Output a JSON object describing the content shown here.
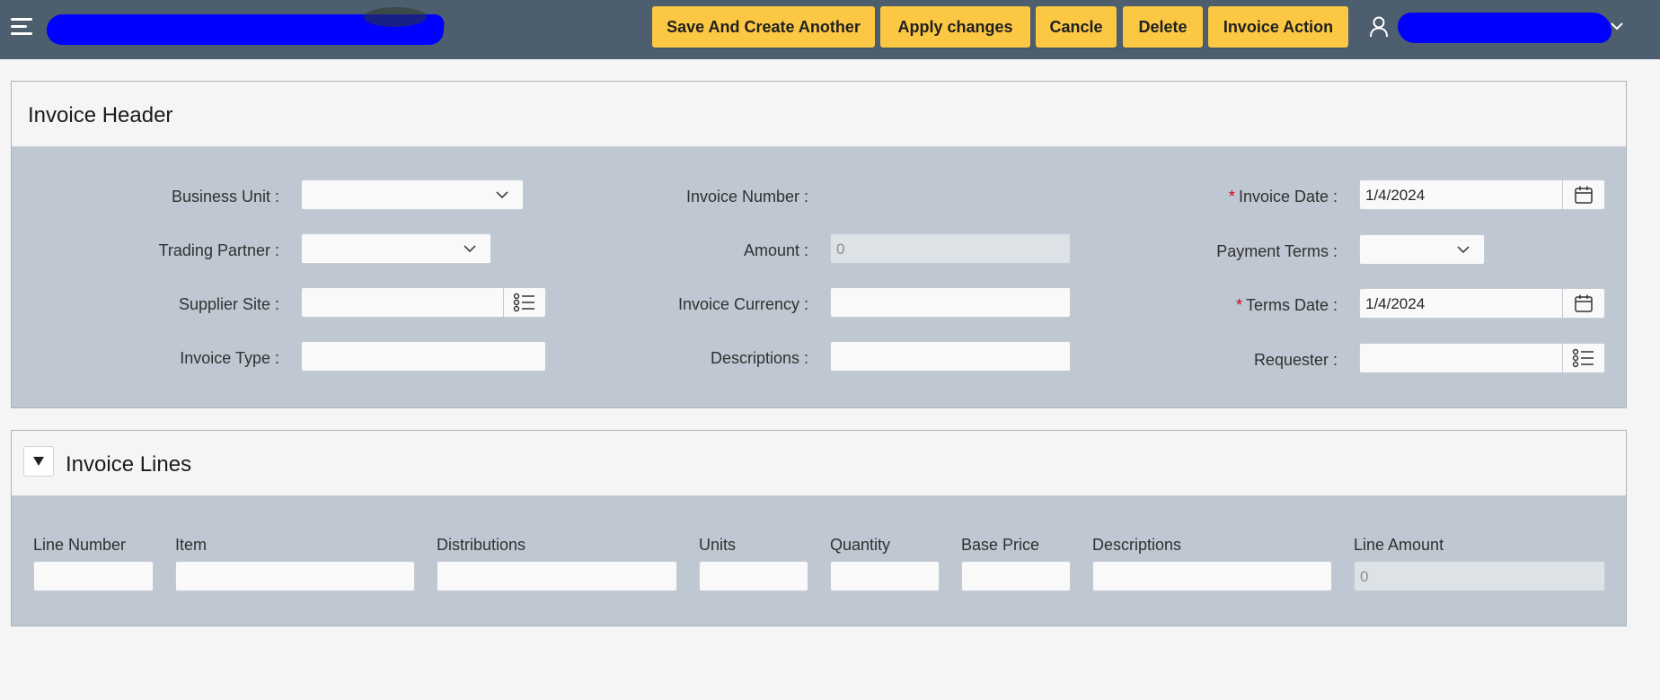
{
  "toolbar": {
    "buttons": [
      {
        "label": "Save And Create Another"
      },
      {
        "label": "Apply changes"
      },
      {
        "label": "Cancle"
      },
      {
        "label": "Delete"
      },
      {
        "label": "Invoice Action"
      }
    ],
    "accent_color": "#fcc844",
    "bar_color": "#4d5e6f"
  },
  "header_region": {
    "title": "Invoice Header",
    "fields": {
      "business_unit": {
        "label": "Business Unit :",
        "value": ""
      },
      "trading_partner": {
        "label": "Trading Partner :",
        "value": ""
      },
      "supplier_site": {
        "label": "Supplier Site :",
        "value": ""
      },
      "invoice_type": {
        "label": "Invoice Type :",
        "value": ""
      },
      "invoice_number": {
        "label": "Invoice Number :",
        "value": ""
      },
      "amount": {
        "label": "Amount :",
        "value": "0"
      },
      "invoice_currency": {
        "label": "Invoice Currency :",
        "value": ""
      },
      "descriptions": {
        "label": "Descriptions :",
        "value": ""
      },
      "invoice_date": {
        "label": "Invoice Date :",
        "value": "1/4/2024",
        "required": "*"
      },
      "payment_terms": {
        "label": "Payment Terms :",
        "value": ""
      },
      "terms_date": {
        "label": "Terms Date :",
        "value": "1/4/2024",
        "required": "*"
      },
      "requester": {
        "label": "Requester :",
        "value": ""
      }
    }
  },
  "lines_region": {
    "title": "Invoice Lines",
    "columns": {
      "line_number": {
        "label": "Line Number",
        "value": ""
      },
      "item": {
        "label": "Item",
        "value": ""
      },
      "distributions": {
        "label": "Distributions",
        "value": ""
      },
      "units": {
        "label": "Units",
        "value": ""
      },
      "quantity": {
        "label": "Quantity",
        "value": ""
      },
      "base_price": {
        "label": "Base Price",
        "value": ""
      },
      "descriptions": {
        "label": "Descriptions",
        "value": ""
      },
      "line_amount": {
        "label": "Line Amount",
        "value": "0"
      }
    }
  },
  "icons": {
    "menu": "hamburger-icon",
    "user": "user-icon",
    "calendar": "calendar-icon",
    "list": "list-icon",
    "chevron": "chevron-down-icon",
    "collapse": "triangle-down-icon"
  }
}
